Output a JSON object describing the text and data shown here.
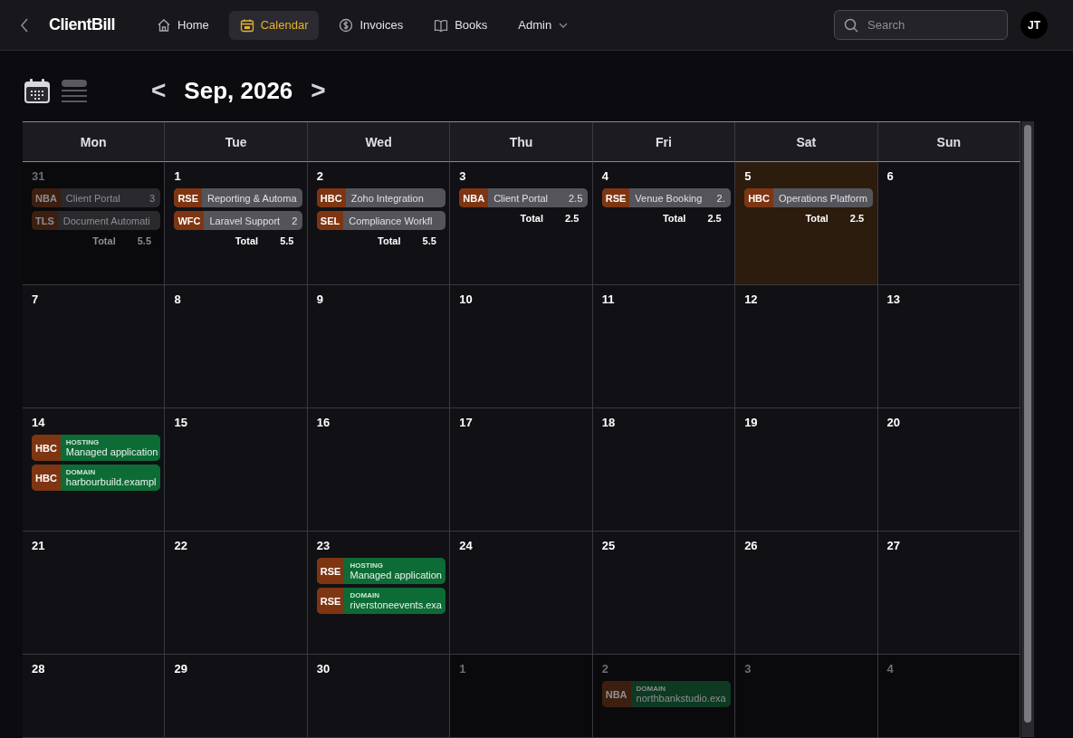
{
  "app": {
    "title": "ClientBill"
  },
  "nav": [
    {
      "label": "Home",
      "selected": false
    },
    {
      "label": "Calendar",
      "selected": true
    },
    {
      "label": "Invoices",
      "selected": false
    },
    {
      "label": "Books",
      "selected": false
    },
    {
      "label": "Admin",
      "selected": false
    }
  ],
  "search": {
    "placeholder": "Search"
  },
  "user": {
    "initials": "JT"
  },
  "view_toggle": [
    {
      "kind": "month",
      "selected": true
    },
    {
      "kind": "list",
      "selected": false
    }
  ],
  "month": {
    "prev": "<",
    "title": "Sep, 2026",
    "next": ">"
  },
  "weekdays": [
    "Mon",
    "Tue",
    "Wed",
    "Thu",
    "Fri",
    "Sat",
    "Sun"
  ],
  "weeks": [
    [
      {
        "day": "31",
        "outside": true,
        "today": false,
        "events": [
          {
            "kind": "work",
            "code": "NBA",
            "title": "Client Portal",
            "hours": "3"
          },
          {
            "kind": "work",
            "code": "TLS",
            "title": "Document Automati"
          }
        ],
        "total": {
          "label": "Total",
          "value": "5.5"
        }
      },
      {
        "day": "1",
        "outside": false,
        "today": false,
        "events": [
          {
            "kind": "work",
            "code": "RSE",
            "title": "Reporting & Automa"
          },
          {
            "kind": "work",
            "code": "WFC",
            "title": "Laravel Support",
            "hours": "2"
          }
        ],
        "total": {
          "label": "Total",
          "value": "5.5"
        }
      },
      {
        "day": "2",
        "outside": false,
        "today": false,
        "events": [
          {
            "kind": "work",
            "code": "HBC",
            "title": "Zoho Integration"
          },
          {
            "kind": "work",
            "code": "SEL",
            "title": "Compliance Workfl"
          }
        ],
        "total": {
          "label": "Total",
          "value": "5.5"
        }
      },
      {
        "day": "3",
        "outside": false,
        "today": false,
        "events": [
          {
            "kind": "work",
            "code": "NBA",
            "title": "Client Portal",
            "hours": "2.5"
          }
        ],
        "total": {
          "label": "Total",
          "value": "2.5"
        }
      },
      {
        "day": "4",
        "outside": false,
        "today": false,
        "events": [
          {
            "kind": "work",
            "code": "RSE",
            "title": "Venue Booking",
            "hours": "2."
          }
        ],
        "total": {
          "label": "Total",
          "value": "2.5"
        }
      },
      {
        "day": "5",
        "outside": false,
        "today": true,
        "events": [
          {
            "kind": "work",
            "code": "HBC",
            "title": "Operations Platform"
          }
        ],
        "total": {
          "label": "Total",
          "value": "2.5"
        }
      },
      {
        "day": "6",
        "outside": false,
        "today": false
      }
    ],
    [
      {
        "day": "7",
        "outside": false,
        "today": false
      },
      {
        "day": "8",
        "outside": false,
        "today": false
      },
      {
        "day": "9",
        "outside": false,
        "today": false
      },
      {
        "day": "10",
        "outside": false,
        "today": false
      },
      {
        "day": "11",
        "outside": false,
        "today": false
      },
      {
        "day": "12",
        "outside": false,
        "today": false
      },
      {
        "day": "13",
        "outside": false,
        "today": false
      }
    ],
    [
      {
        "day": "14",
        "outside": false,
        "today": false,
        "events": [
          {
            "kind": "renewal",
            "code": "HBC",
            "type": "HOSTING",
            "title": "Managed application"
          },
          {
            "kind": "renewal",
            "code": "HBC",
            "type": "DOMAIN",
            "title": "harbourbuild.exampl"
          }
        ]
      },
      {
        "day": "15",
        "outside": false,
        "today": false
      },
      {
        "day": "16",
        "outside": false,
        "today": false
      },
      {
        "day": "17",
        "outside": false,
        "today": false
      },
      {
        "day": "18",
        "outside": false,
        "today": false
      },
      {
        "day": "19",
        "outside": false,
        "today": false
      },
      {
        "day": "20",
        "outside": false,
        "today": false
      }
    ],
    [
      {
        "day": "21",
        "outside": false,
        "today": false
      },
      {
        "day": "22",
        "outside": false,
        "today": false
      },
      {
        "day": "23",
        "outside": false,
        "today": false,
        "events": [
          {
            "kind": "renewal",
            "code": "RSE",
            "type": "HOSTING",
            "title": "Managed application"
          },
          {
            "kind": "renewal",
            "code": "RSE",
            "type": "DOMAIN",
            "title": "riverstoneevents.exa"
          }
        ]
      },
      {
        "day": "24",
        "outside": false,
        "today": false
      },
      {
        "day": "25",
        "outside": false,
        "today": false
      },
      {
        "day": "26",
        "outside": false,
        "today": false
      },
      {
        "day": "27",
        "outside": false,
        "today": false
      }
    ],
    [
      {
        "day": "28",
        "outside": false,
        "today": false
      },
      {
        "day": "29",
        "outside": false,
        "today": false
      },
      {
        "day": "30",
        "outside": false,
        "today": false
      },
      {
        "day": "1",
        "outside": true,
        "today": false
      },
      {
        "day": "2",
        "outside": true,
        "today": false,
        "events": [
          {
            "kind": "renewal",
            "code": "NBA",
            "type": "DOMAIN",
            "title": "northbankstudio.exa"
          }
        ]
      },
      {
        "day": "3",
        "outside": true,
        "today": false
      },
      {
        "day": "4",
        "outside": true,
        "today": false
      }
    ]
  ]
}
